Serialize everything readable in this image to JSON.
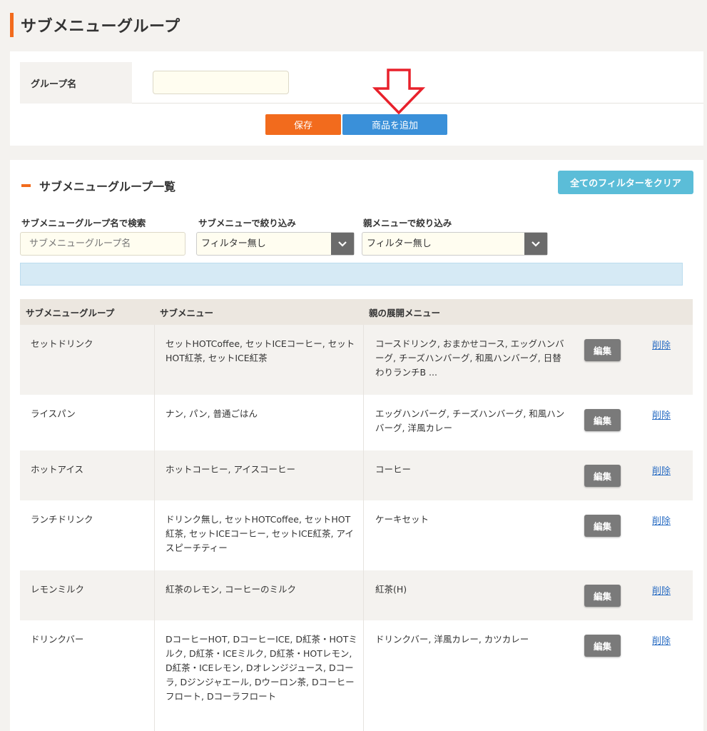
{
  "page": {
    "title": "サブメニューグループ"
  },
  "form": {
    "group_name_label": "グループ名",
    "group_name_value": "",
    "save_label": "保存",
    "add_product_label": "商品を追加"
  },
  "list": {
    "heading": "サブメニューグループ一覧",
    "clear_filters_label": "全てのフィルターをクリア",
    "search_label": "サブメニューグループ名で検索",
    "search_placeholder": "サブメニューグループ名",
    "submenu_filter_label": "サブメニューで絞り込み",
    "submenu_filter_value": "フィルター無し",
    "parent_filter_label": "親メニューで絞り込み",
    "parent_filter_value": "フィルター無し"
  },
  "table": {
    "headers": [
      "サブメニューグループ",
      "サブメニュー",
      "親の展開メニュー"
    ],
    "edit_label": "編集",
    "delete_label": "削除",
    "rows": [
      {
        "group": "セットドリンク",
        "submenu": "セットHOTCoffee, セットICEコーヒー, セットHOT紅茶, セットICE紅茶",
        "parent": "コースドリンク, おまかせコース, エッグハンバーグ, チーズハンバーグ, 和風ハンバーグ, 日替わりランチB ..."
      },
      {
        "group": "ライスパン",
        "submenu": "ナン, パン, 普通ごはん",
        "parent": "エッグハンバーグ, チーズハンバーグ, 和風ハンバーグ, 洋風カレー"
      },
      {
        "group": "ホットアイス",
        "submenu": "ホットコーヒー, アイスコーヒー",
        "parent": "コーヒー"
      },
      {
        "group": "ランチドリンク",
        "submenu": "ドリンク無し, セットHOTCoffee, セットHOT紅茶, セットICEコーヒー, セットICE紅茶, アイスピーチティー",
        "parent": "ケーキセット"
      },
      {
        "group": "レモンミルク",
        "submenu": "紅茶のレモン, コーヒーのミルク",
        "parent": "紅茶(H)"
      },
      {
        "group": "ドリンクバー",
        "submenu": "DコーヒーHOT, DコーヒーICE, D紅茶・HOTミルク, D紅茶・ICEミルク, D紅茶・HOTレモン, D紅茶・ICEレモン, Dオレンジジュース, Dコーラ, Dジンジャエール, Dウーロン茶, Dコーヒーフロート, Dコーラフロート",
        "parent": "ドリンクバー, 洋風カレー, カツカレー"
      }
    ]
  },
  "colors": {
    "accent": "#f26b1d",
    "primary": "#3a90d9",
    "info": "#5bbdd8",
    "annotation": "#e8212b"
  },
  "icons": {
    "annotation_arrow": "down-arrow-icon",
    "select_caret": "chevron-down-icon"
  }
}
